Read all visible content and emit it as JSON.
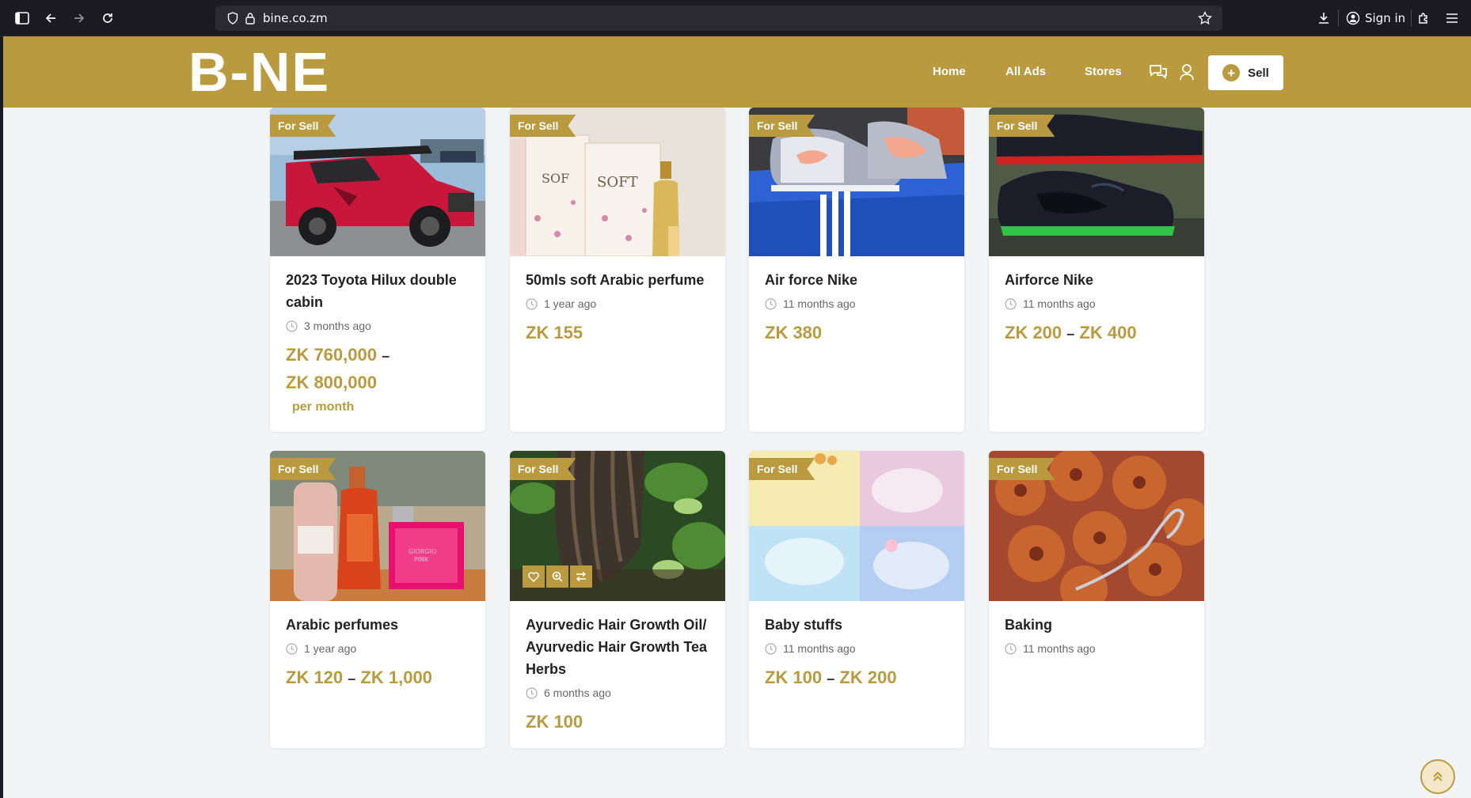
{
  "browser": {
    "url": "bine.co.zm",
    "sign_in": "Sign in"
  },
  "header": {
    "logo": "B-NE",
    "nav": [
      "Home",
      "All Ads",
      "Stores"
    ],
    "sell_label": "Sell",
    "brand_color": "#b99a3f"
  },
  "listings": [
    {
      "badge": "For Sell",
      "title": "2023 Toyota Hilux double cabin",
      "time": "3 months ago",
      "price_from": "ZK 760,000",
      "price_to": "ZK 800,000",
      "per": "per month",
      "image": "red-pickup-truck"
    },
    {
      "badge": "For Sell",
      "title": "50mls soft Arabic perfume",
      "time": "1 year ago",
      "price": "ZK 155",
      "image": "perfume-boxes"
    },
    {
      "badge": "For Sell",
      "title": "Air force Nike",
      "time": "11 months ago",
      "price": "ZK 380",
      "image": "sneakers-on-box"
    },
    {
      "badge": "For Sell",
      "title": "Airforce Nike",
      "time": "11 months ago",
      "price_from": "ZK 200",
      "price_to": "ZK 400",
      "image": "black-sneakers"
    },
    {
      "badge": "For Sell",
      "title": "Arabic perfumes",
      "time": "1 year ago",
      "price_from": "ZK 120",
      "price_to": "ZK 1,000",
      "image": "perfume-bottles"
    },
    {
      "badge": "For Sell",
      "title": "Ayurvedic Hair Growth Oil/ Ayurvedic Hair Growth Tea Herbs",
      "time": "6 months ago",
      "price": "ZK 100",
      "image": "dreadlocks-hair"
    },
    {
      "badge": "For Sell",
      "title": "Baby stuffs",
      "time": "11 months ago",
      "price_from": "ZK 100",
      "price_to": "ZK 200",
      "image": "baby-clothes"
    },
    {
      "badge": "For Sell",
      "title": "Baking",
      "time": "11 months ago",
      "image": "fried-doughnuts"
    }
  ]
}
